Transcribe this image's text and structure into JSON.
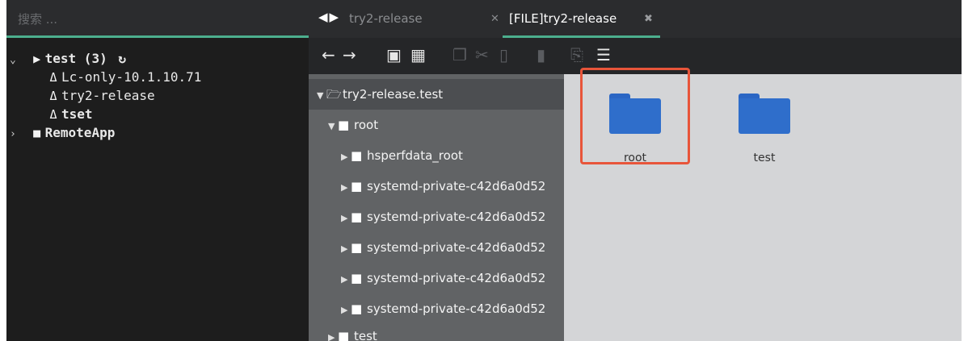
{
  "search": {
    "placeholder": "搜索 ..."
  },
  "host_tree": {
    "group": {
      "label": "test (3)",
      "expanded": true
    },
    "hosts": [
      {
        "label": "Lc-only-10.1.10.71"
      },
      {
        "label": "try2-release"
      },
      {
        "label": "tset"
      }
    ],
    "collapsed_group": {
      "label": "RemoteApp"
    }
  },
  "tabs": [
    {
      "label": "try2-release",
      "active": false
    },
    {
      "label": "[FILE]try2-release",
      "active": true
    }
  ],
  "toolbar": {
    "icons": [
      "back-icon",
      "forward-icon",
      "new-folder-icon",
      "new-file-icon",
      "copy-icon",
      "cut-icon",
      "paste-icon",
      "delete-icon",
      "rename-icon",
      "list-view-icon"
    ]
  },
  "dir_tree": {
    "root_node": "try2-release.test",
    "items": [
      {
        "label": "root",
        "level": 1,
        "expanded": true
      },
      {
        "label": "hsperfdata_root",
        "level": 2
      },
      {
        "label": "systemd-private-c42d6a0d52",
        "level": 2
      },
      {
        "label": "systemd-private-c42d6a0d52",
        "level": 2
      },
      {
        "label": "systemd-private-c42d6a0d52",
        "level": 2
      },
      {
        "label": "systemd-private-c42d6a0d52",
        "level": 2
      },
      {
        "label": "systemd-private-c42d6a0d52",
        "level": 2
      },
      {
        "label": "test",
        "level": 1
      }
    ]
  },
  "files": [
    {
      "name": "root",
      "type": "folder",
      "highlighted": true
    },
    {
      "name": "test",
      "type": "folder",
      "highlighted": false
    }
  ],
  "colors": {
    "accent": "#4caf8e",
    "folder": "#2f6ecb",
    "highlight": "#e8553a"
  }
}
